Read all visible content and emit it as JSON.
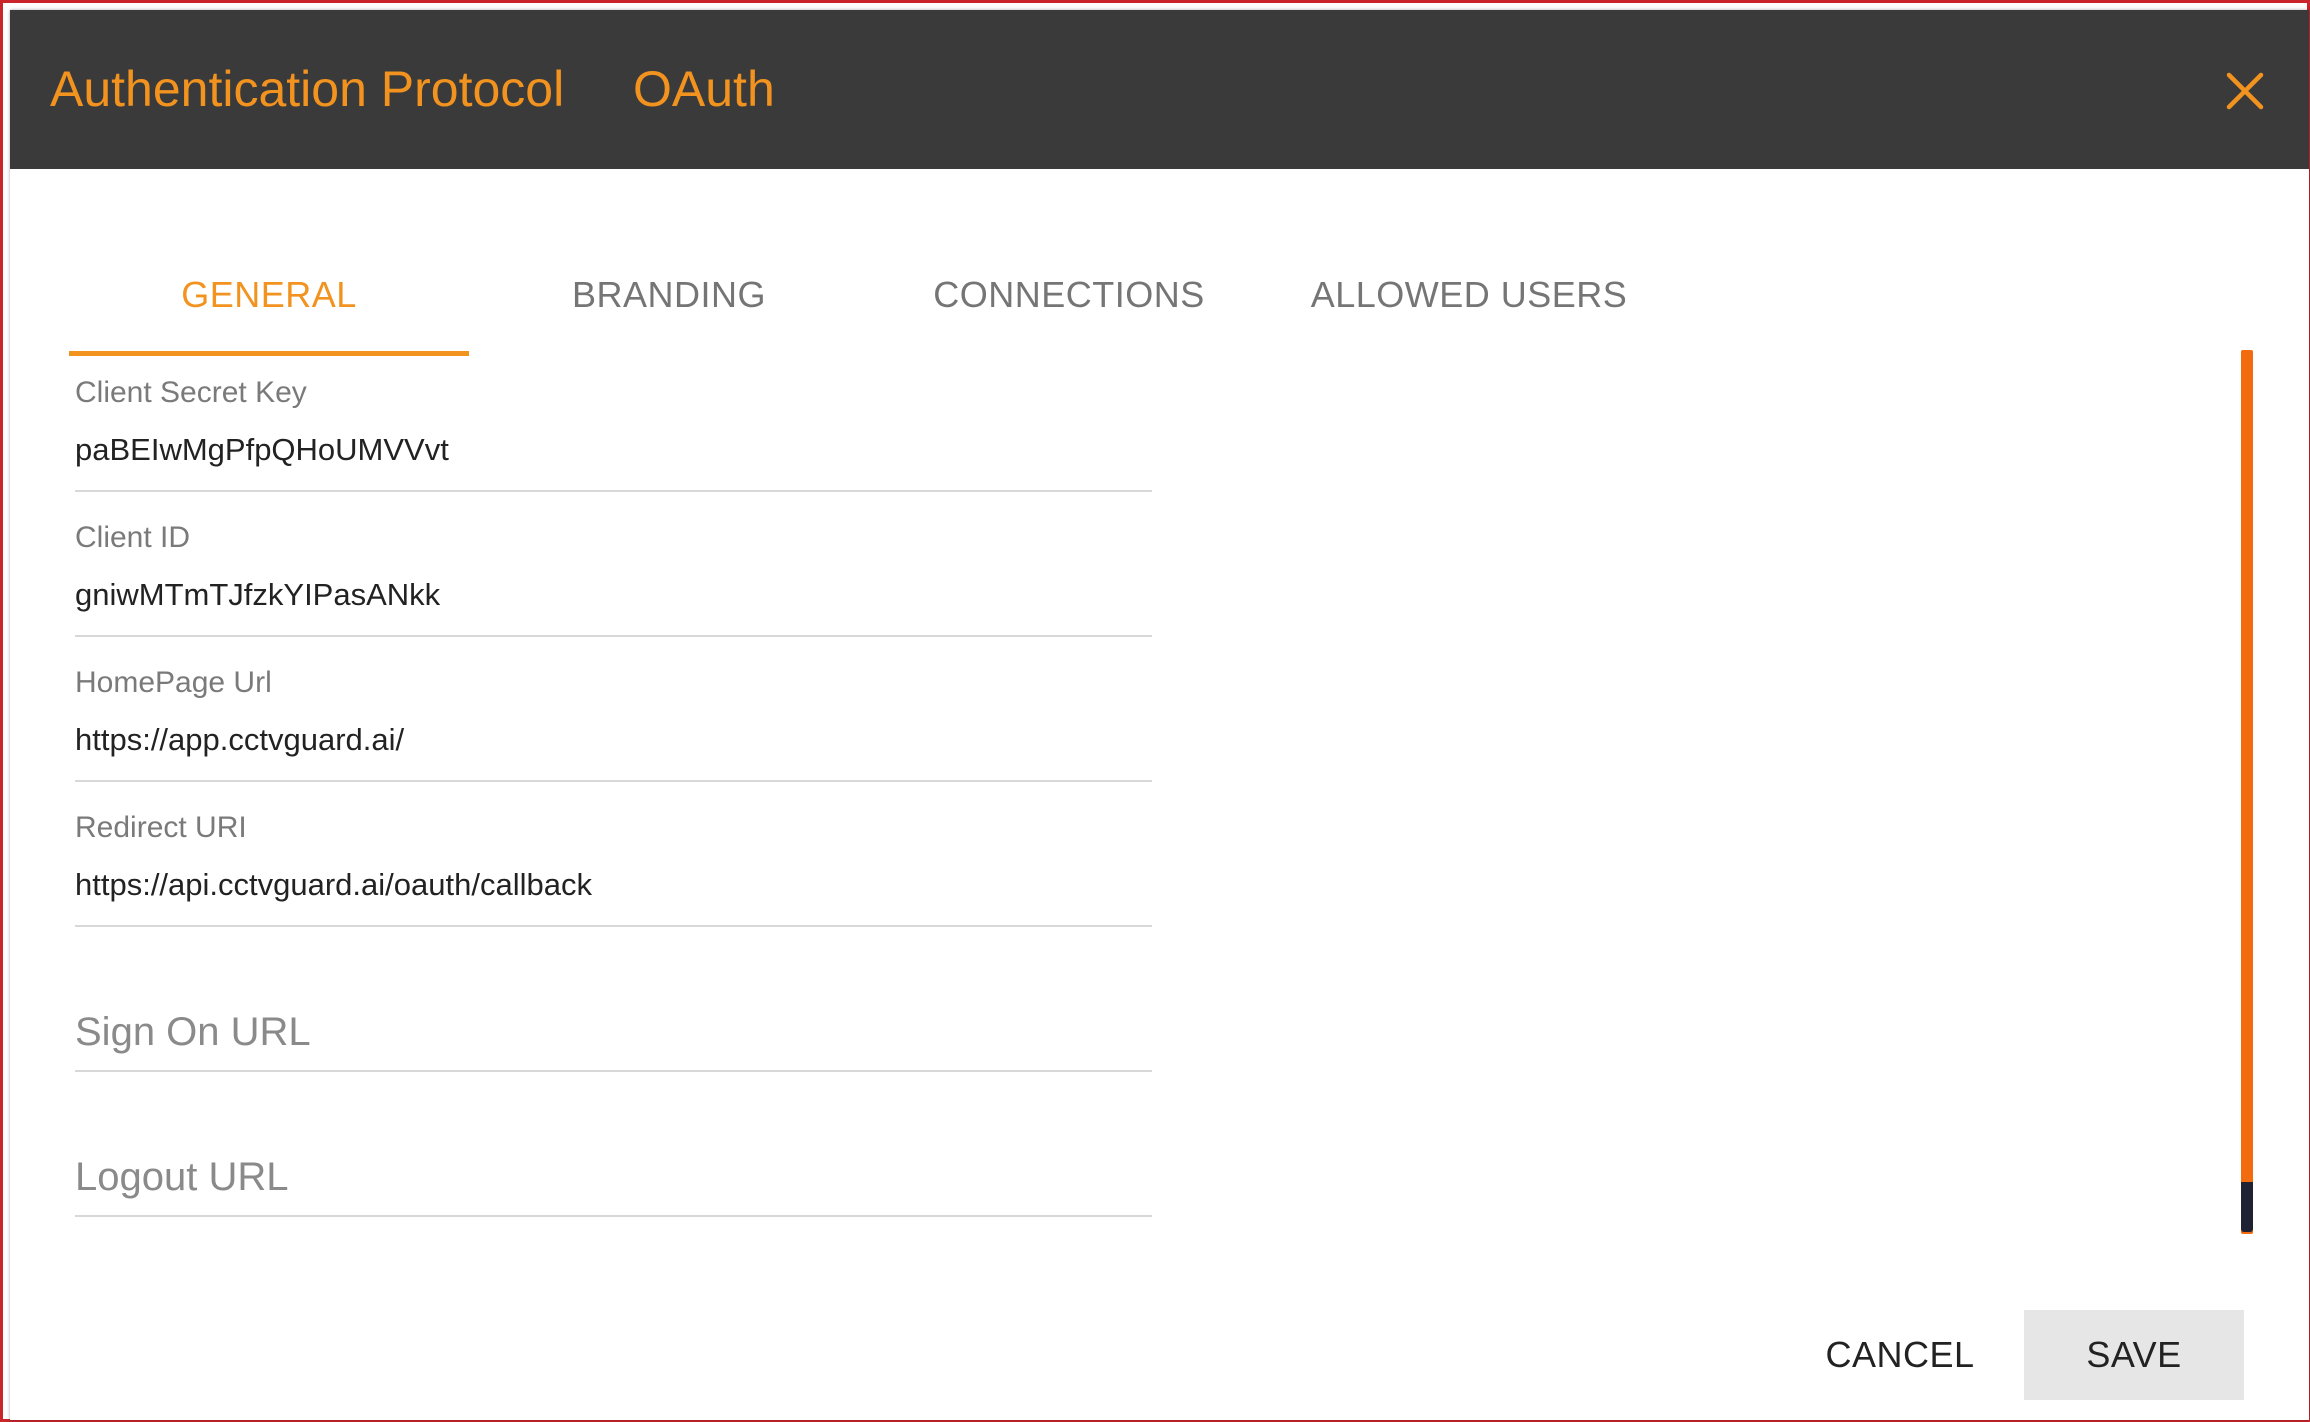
{
  "header": {
    "title": "Authentication Protocol",
    "protocol_value": "OAuth",
    "close_icon": "close-icon"
  },
  "tabs": [
    {
      "label": "GENERAL",
      "active": true
    },
    {
      "label": "BRANDING",
      "active": false
    },
    {
      "label": "CONNECTIONS",
      "active": false
    },
    {
      "label": "ALLOWED USERS",
      "active": false
    }
  ],
  "form": {
    "client_secret_key": {
      "label": "Client Secret Key",
      "value": "paBEIwMgPfpQHoUMVVvt"
    },
    "client_id": {
      "label": "Client ID",
      "value": "gniwMTmTJfzkYIPasANkk"
    },
    "homepage_url": {
      "label": "HomePage Url",
      "value": "https://app.cctvguard.ai/"
    },
    "redirect_uri": {
      "label": "Redirect URI",
      "value": "https://api.cctvguard.ai/oauth/callback"
    },
    "sign_on_url": {
      "placeholder": "Sign On URL",
      "value": ""
    },
    "logout_url": {
      "placeholder": "Logout URL",
      "value": ""
    }
  },
  "footer": {
    "cancel_label": "CANCEL",
    "save_label": "SAVE"
  },
  "colors": {
    "accent": "#f2931f",
    "header_bg": "#3a3a3a",
    "scrollbar": "#f26b0f",
    "scroll_thumb": "#1e2233"
  }
}
